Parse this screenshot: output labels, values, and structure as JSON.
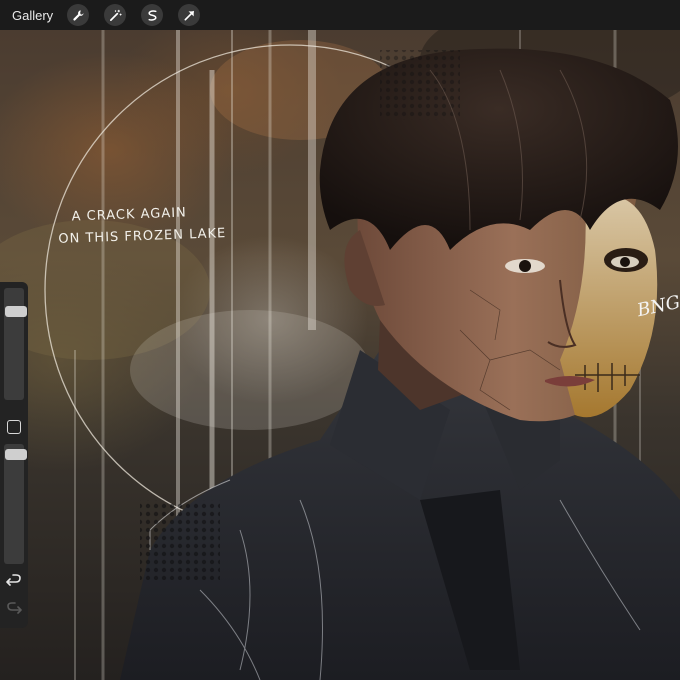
{
  "toolbar": {
    "gallery_label": "Gallery",
    "tools": [
      "wrench-icon",
      "magic-wand-icon",
      "selection-icon",
      "arrow-icon"
    ]
  },
  "artwork": {
    "quote_line1": "A CRACK AGAIN",
    "quote_line2": "ON THIS FROZEN LAKE",
    "signature": "BNG"
  },
  "sidebar": {
    "brush_size_level": 0.18,
    "opacity_level": 0.05
  },
  "colors": {
    "toolbar_bg": "#1b1b1b",
    "sidebar_bg": "#232323",
    "tool_button_bg": "#3a3a3a"
  }
}
